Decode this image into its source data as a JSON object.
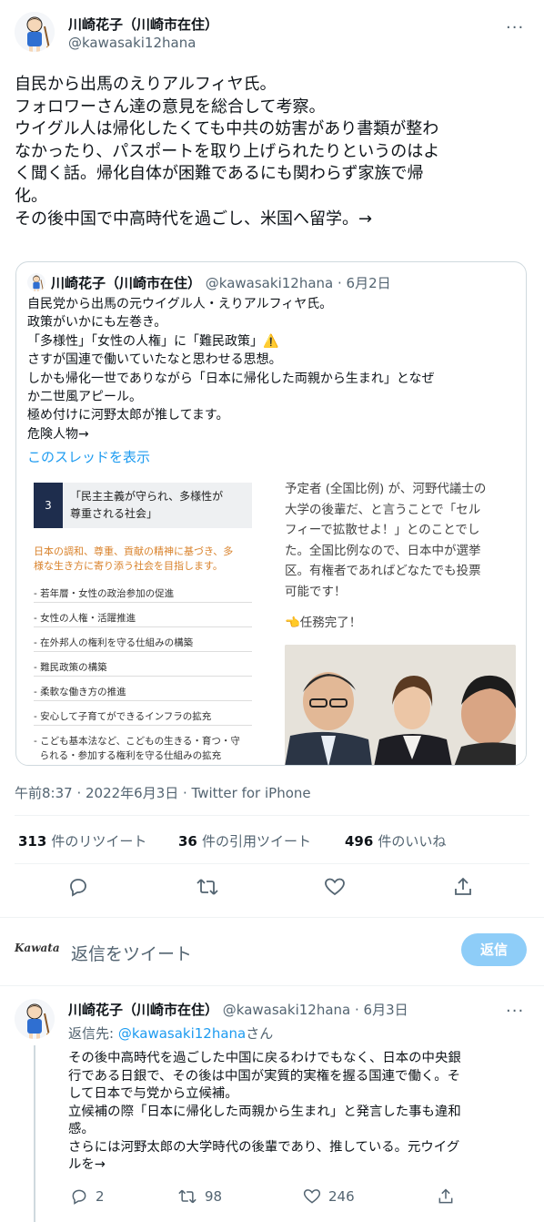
{
  "main_tweet": {
    "display_name": "川崎花子（川崎市在住）",
    "handle": "@kawasaki12hana",
    "more": "···",
    "lines": [
      "自民から出馬のえりアルフィヤ氏。",
      "フォロワーさん達の意見を総合して考察。",
      "ウイグル人は帰化したくても中共の妨害があり書類が整わ",
      "なかったり、パスポートを取り上げられたりというのはよ",
      "く聞く話。帰化自体が困難であるにも関わらず家族で帰",
      "化。",
      "その後中国で中高時代を過ごし、米国へ留学。→"
    ]
  },
  "quoted_tweet": {
    "display_name": "川崎花子（川崎市在住）",
    "handle": "@kawasaki12hana",
    "date": "· 6月2日",
    "lines": [
      "自民党から出馬の元ウイグル人・えりアルフィヤ氏。",
      "政策がいかにも左巻き。",
      "「多様性」「女性の人権」に「難民政策」⚠️",
      "さすが国連で働いていたなと思わせる思想。",
      "しかも帰化一世でありながら「日本に帰化した両親から生まれ」となぜ",
      "か二世風アピール。",
      "極め付けに河野太郎が推してます。",
      "危険人物→"
    ],
    "thread_link": "このスレッドを表示",
    "doc": {
      "number": "3",
      "heading_line1": "「民主主義が守られ、多様性が",
      "heading_line2": "尊重される社会」",
      "lead_line1": "日本の調和、尊重、貢献の精神に基づき、多",
      "lead_line2": "様な生き方に寄り添う社会を目指します。",
      "items": [
        "- 若年層・女性の政治参加の促進",
        "- 女性の人権・活躍推進",
        "- 在外邦人の権利を守る仕組みの構築",
        "- 難民政策の構築",
        "- 柔軟な働き方の推進",
        "- 安心して子育てができるインフラの拡充",
        "- こども基本法など、こどもの生きる・育つ・守",
        "  られる・参加する権利を守る仕組みの拡充"
      ]
    },
    "right_text": [
      "予定者 (全国比例) が、河野代議士の",
      "大学の後輩だ、と言うことで「セル",
      "フィーで拡散せよ！」とのことでし",
      "た。全国比例なので、日本中が選挙",
      "区。有権者であればどなたでも投票",
      "可能です！"
    ],
    "right_done": "👈任務完了！"
  },
  "timestamp": "午前8:37 · 2022年6月3日 · Twitter for iPhone",
  "stats": {
    "retweets_num": "313",
    "retweets_label": "件のリツイート",
    "quotes_num": "36",
    "quotes_label": "件の引用ツイート",
    "likes_num": "496",
    "likes_label": "件のいいね"
  },
  "reply_box": {
    "logo_text": "Kawata",
    "placeholder": "返信をツイート",
    "button": "返信"
  },
  "reply_tweet": {
    "display_name": "川崎花子（川崎市在住）",
    "handle": "@kawasaki12hana",
    "date": "· 6月3日",
    "more": "···",
    "replying_prefix": "返信先: ",
    "replying_handle": "@kawasaki12hana",
    "replying_suffix": "さん",
    "lines": [
      "その後中高時代を過ごした中国に戻るわけでもなく、日本の中央銀",
      "行である日銀で、その後は中国が実質的実権を握る国連で働く。そ",
      "して日本で与党から立候補。",
      "立候補の際「日本に帰化した両親から生まれ」と発言した事も違和",
      "感。",
      "さらには河野太郎の大学時代の後輩であり、推している。元ウイグ",
      "ルを→"
    ],
    "reply_count": "2",
    "retweet_count": "98",
    "like_count": "246"
  },
  "colors": {
    "accent": "#1d9bf0",
    "secondary_text": "#536471",
    "border": "#cfd9de"
  }
}
